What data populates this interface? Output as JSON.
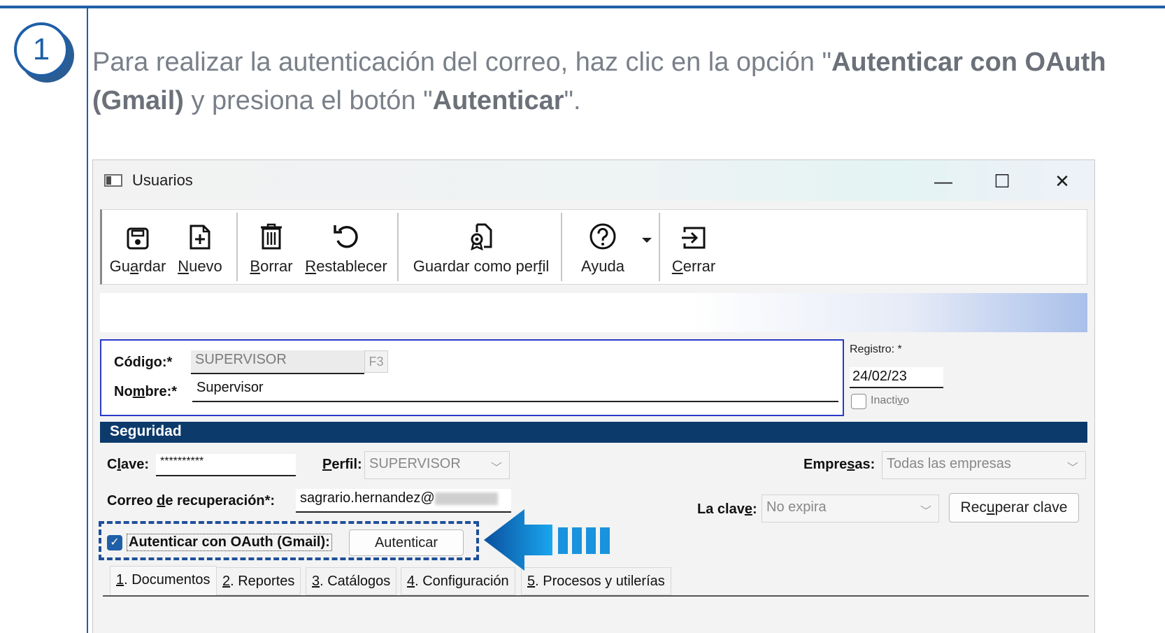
{
  "step": {
    "number": "1"
  },
  "instruction": {
    "p1": " Para realizar la autenticación del correo, haz clic en la opción \"",
    "b1": "Autenticar con OAuth (Gmail)",
    "p2": " y presiona el botón \"",
    "b2": "Autenticar",
    "p3": "\"."
  },
  "window": {
    "title": "Usuarios",
    "controls": {
      "minimize": "—",
      "maximize": "☐",
      "close": "✕"
    }
  },
  "toolbar": {
    "save": {
      "pre": "Gu",
      "u": "a",
      "post": "rdar",
      "icon": "save-icon"
    },
    "new": {
      "pre": "",
      "u": "N",
      "post": "uevo",
      "icon": "new-document-icon"
    },
    "delete": {
      "pre": "",
      "u": "B",
      "post": "orrar",
      "icon": "trash-icon"
    },
    "reset": {
      "pre": "",
      "u": "R",
      "post": "establecer",
      "icon": "undo-icon"
    },
    "save_profile": {
      "pre": "Guardar como per",
      "u": "f",
      "post": "il",
      "icon": "certificate-document-icon"
    },
    "help": {
      "label": "Ayuda",
      "icon": "question-icon"
    },
    "close": {
      "pre": "",
      "u": "C",
      "post": "errar",
      "icon": "exit-icon"
    }
  },
  "form": {
    "codigo": {
      "label_pre": "Códi",
      "label_u": "g",
      "label_post": "o:*",
      "value": "SUPERVISOR",
      "key": "F3"
    },
    "nombre": {
      "label_pre": "No",
      "label_u": "m",
      "label_post": "bre:*",
      "value": "Supervisor"
    },
    "registro": {
      "label_pre": "Re",
      "label_u": "g",
      "label_post": "istro: *",
      "value": "24/02/23"
    },
    "inactivo": {
      "pre": "Inacti",
      "u": "v",
      "post": "o",
      "checked": false
    }
  },
  "security": {
    "header": "Seguridad",
    "clave": {
      "pre": "C",
      "u": "l",
      "post": "ave:",
      "value": "**********"
    },
    "perfil": {
      "pre": "",
      "u": "P",
      "post": "erfil:",
      "value": "SUPERVISOR"
    },
    "empresas": {
      "pre": "Empre",
      "u": "s",
      "post": "as:",
      "value": "Todas las empresas"
    },
    "correo": {
      "pre": "Correo ",
      "u": "d",
      "post": "e recuperación*:",
      "value": "sagrario.hernandez@"
    },
    "la_clave": {
      "pre": "La clav",
      "u": "e",
      "post": ":",
      "value": "No expira"
    },
    "recuperar": {
      "pre": "Rec",
      "u": "u",
      "post": "perar clave"
    },
    "oauth": {
      "label": "Autenticar con OAuth (Gmail):",
      "checked": true
    },
    "autenticar_button": "Autenticar"
  },
  "tabs": [
    {
      "u": "1",
      "post": ". Documentos"
    },
    {
      "u": "2",
      "post": ". Reportes"
    },
    {
      "u": "3",
      "post": ". Catálogos"
    },
    {
      "u": "4",
      "post": ". Configuración"
    },
    {
      "u": "5",
      "post": ". Procesos y utilerías"
    }
  ],
  "colors": {
    "accent": "#1f5fa8",
    "section_header": "#0c3a6b",
    "highlight_arrow": "#0b66b7"
  }
}
